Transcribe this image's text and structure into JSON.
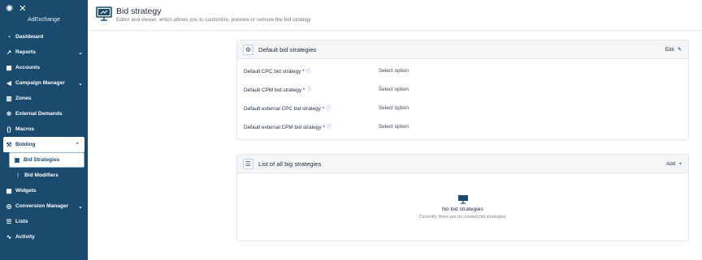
{
  "sidebar": {
    "brand": "AdExchange",
    "items": [
      {
        "label": "Dashboard",
        "icon": "gauge-icon",
        "glyph": "◔"
      },
      {
        "label": "Reports",
        "icon": "chart-icon",
        "glyph": "↗",
        "chevron": "⌄"
      },
      {
        "label": "Accounts",
        "icon": "accounts-icon",
        "glyph": "▦"
      },
      {
        "label": "Campaign Manager",
        "icon": "megaphone-icon",
        "glyph": "◀",
        "chevron": "⌄"
      },
      {
        "label": "Zones",
        "icon": "zones-icon",
        "glyph": "▥"
      },
      {
        "label": "External Demands",
        "icon": "gear-icon",
        "glyph": "✲"
      },
      {
        "label": "Macros",
        "icon": "braces-icon",
        "glyph": "{}"
      },
      {
        "label": "Bidding",
        "icon": "gavel-icon",
        "glyph": "⚒",
        "chevron": "⌃"
      },
      {
        "label": "Bid Strategies",
        "icon": "strategy-icon",
        "glyph": "▣"
      },
      {
        "label": "Bid Modifiers",
        "icon": "sliders-icon",
        "glyph": "⫶"
      },
      {
        "label": "Widgets",
        "icon": "widgets-icon",
        "glyph": "▦"
      },
      {
        "label": "Conversion Manager",
        "icon": "conversion-icon",
        "glyph": "◎",
        "chevron": "⌄"
      },
      {
        "label": "Lists",
        "icon": "list-icon",
        "glyph": "☰"
      },
      {
        "label": "Activity",
        "icon": "activity-icon",
        "glyph": "∿"
      }
    ]
  },
  "header": {
    "title": "Bid strategy",
    "subtitle": "Editor and viewer, which allows you to customize, preview or remove the bid strategy"
  },
  "default_card": {
    "title": "Default bid strategies",
    "action": "Edit",
    "action_glyph": "✎",
    "rows": [
      {
        "label": "Default CPC bid strategy *",
        "value": "Select option"
      },
      {
        "label": "Default CPM bid strategy *",
        "value": "Select option"
      },
      {
        "label": "Default external CPC bid strategy *",
        "value": "Select option"
      },
      {
        "label": "Default external CPM bid strategy *",
        "value": "Select option"
      }
    ]
  },
  "list_card": {
    "title": "List of all big strategies",
    "action": "Add",
    "action_glyph": "+",
    "empty_title": "No bid strategies",
    "empty_subtitle": "Currently, there are no created bid strategies."
  },
  "colors": {
    "sidebar": "#1a4a6e",
    "accent": "#3a7bd5"
  }
}
